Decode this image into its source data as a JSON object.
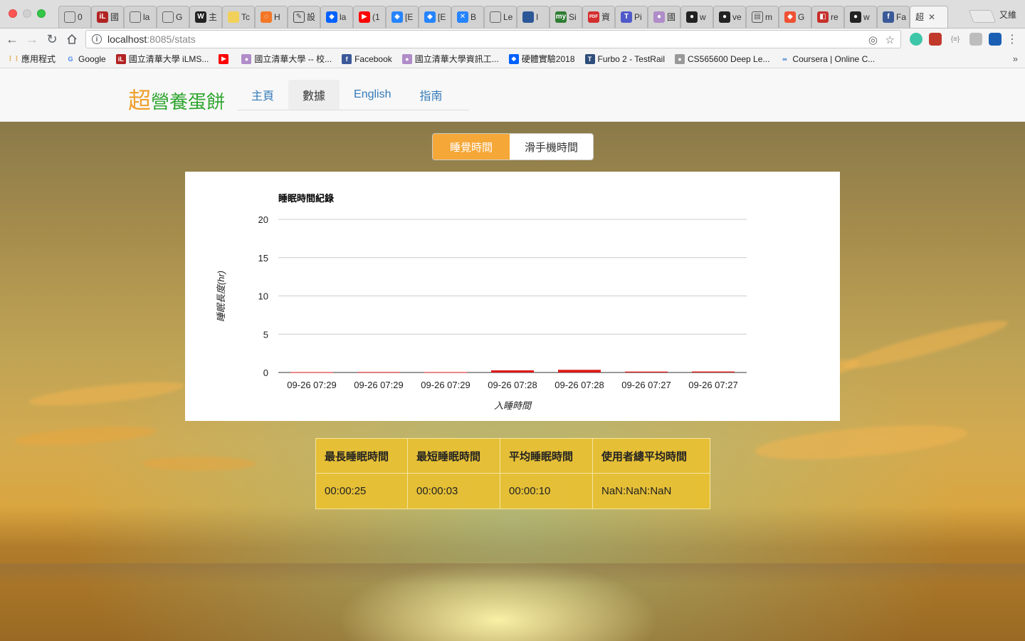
{
  "browser": {
    "tabs": [
      {
        "label": "0",
        "icon": "doc-icon",
        "color": "#666666"
      },
      {
        "label": "國",
        "icon": "ilms-icon",
        "color": "#b22222"
      },
      {
        "label": "la",
        "icon": "doc-icon",
        "color": "#666666"
      },
      {
        "label": "G",
        "icon": "doc-icon",
        "color": "#666666"
      },
      {
        "label": "主",
        "icon": "wikipedia-icon",
        "color": "#222222"
      },
      {
        "label": "Tc",
        "icon": "note-icon",
        "color": "#f2d15a"
      },
      {
        "label": "H",
        "icon": "jupyter-icon",
        "color": "#f37726"
      },
      {
        "label": "設",
        "icon": "edit-icon",
        "color": "#444444"
      },
      {
        "label": "la",
        "icon": "dropbox-icon",
        "color": "#0061fe"
      },
      {
        "label": "(1",
        "icon": "youtube-icon",
        "color": "#ff0000"
      },
      {
        "label": "[E",
        "icon": "diamond-icon",
        "color": "#2684ff"
      },
      {
        "label": "[E",
        "icon": "diamond-icon",
        "color": "#2684ff"
      },
      {
        "label": "B",
        "icon": "confluence-icon",
        "color": "#2684ff"
      },
      {
        "label": "Le",
        "icon": "doc-icon",
        "color": "#666666"
      },
      {
        "label": "I",
        "icon": "chat-icon",
        "color": "#2b5797"
      },
      {
        "label": "Si",
        "icon": "mygov-icon",
        "color": "#2e7d32"
      },
      {
        "label": "資",
        "icon": "pdf-icon",
        "color": "#d32f2f"
      },
      {
        "label": "Pi",
        "icon": "teams-icon",
        "color": "#5059c9"
      },
      {
        "label": "國",
        "icon": "nthu-icon",
        "color": "#b08cc8"
      },
      {
        "label": "w",
        "icon": "github-icon",
        "color": "#222222"
      },
      {
        "label": "ve",
        "icon": "github-icon",
        "color": "#222222"
      },
      {
        "label": "m",
        "icon": "book-icon",
        "color": "#555555"
      },
      {
        "label": "G",
        "icon": "git-icon",
        "color": "#f05133"
      },
      {
        "label": "re",
        "icon": "redis-icon",
        "color": "#c6302b"
      },
      {
        "label": "w",
        "icon": "github-icon",
        "color": "#222222"
      },
      {
        "label": "Fa",
        "icon": "facebook-icon",
        "color": "#3b5998"
      },
      {
        "label": "超",
        "icon": "none",
        "color": "#ffffff",
        "active": true
      }
    ],
    "profile_name": "又維",
    "url_host": "localhost",
    "url_rest": ":8085/stats",
    "bookmarks": [
      {
        "label": "應用程式",
        "icon": "apps-icon",
        "color": "#e0a030"
      },
      {
        "label": "Google",
        "icon": "google-icon",
        "color": "#4285f4"
      },
      {
        "label": "國立清華大學 iLMS...",
        "icon": "ilms-icon",
        "color": "#b22222"
      },
      {
        "label": "",
        "icon": "youtube-icon",
        "color": "#ff0000"
      },
      {
        "label": "國立清華大學 -- 校...",
        "icon": "nthu-icon",
        "color": "#b08cc8"
      },
      {
        "label": "Facebook",
        "icon": "facebook-icon",
        "color": "#3b5998"
      },
      {
        "label": "國立清華大學資訊工...",
        "icon": "nthu-icon",
        "color": "#b08cc8"
      },
      {
        "label": "硬體實驗2018",
        "icon": "dropbox-icon",
        "color": "#0061fe"
      },
      {
        "label": "Furbo 2 - TestRail",
        "icon": "testrail-icon",
        "color": "#2e4d7b"
      },
      {
        "label": "CS565600 Deep Le...",
        "icon": "nthu-icon",
        "color": "#999999"
      },
      {
        "label": "Coursera | Online C...",
        "icon": "coursera-icon",
        "color": "#2a73cc"
      }
    ]
  },
  "site": {
    "brand_accent": "超",
    "brand_rest": "營養蛋餅",
    "nav": [
      "主頁",
      "數據",
      "English",
      "指南"
    ],
    "active_nav_index": 1
  },
  "toggle": {
    "sleep": "睡覺時間",
    "phone": "滑手機時間",
    "active": "sleep"
  },
  "chart_data": {
    "type": "bar",
    "title": "睡眠時間紀錄",
    "xlabel": "入睡時間",
    "ylabel": "睡眠長度(hr)",
    "ylim": [
      0,
      20
    ],
    "yticks": [
      0,
      5,
      10,
      15,
      20
    ],
    "grid": true,
    "categories": [
      "09-26 07:29",
      "09-26 07:29",
      "09-26 07:29",
      "09-26 07:28",
      "09-26 07:28",
      "09-26 07:27",
      "09-26 07:27"
    ],
    "values": [
      0.05,
      0.06,
      0.05,
      0.28,
      0.35,
      0.12,
      0.13
    ],
    "bar_color": "#dd1a1a"
  },
  "stats": {
    "headers": [
      "最長睡眠時間",
      "最短睡眠時間",
      "平均睡眠時間",
      "使用者總平均時間"
    ],
    "values": [
      "00:00:25",
      "00:00:03",
      "00:00:10",
      "NaN:NaN:NaN"
    ]
  }
}
